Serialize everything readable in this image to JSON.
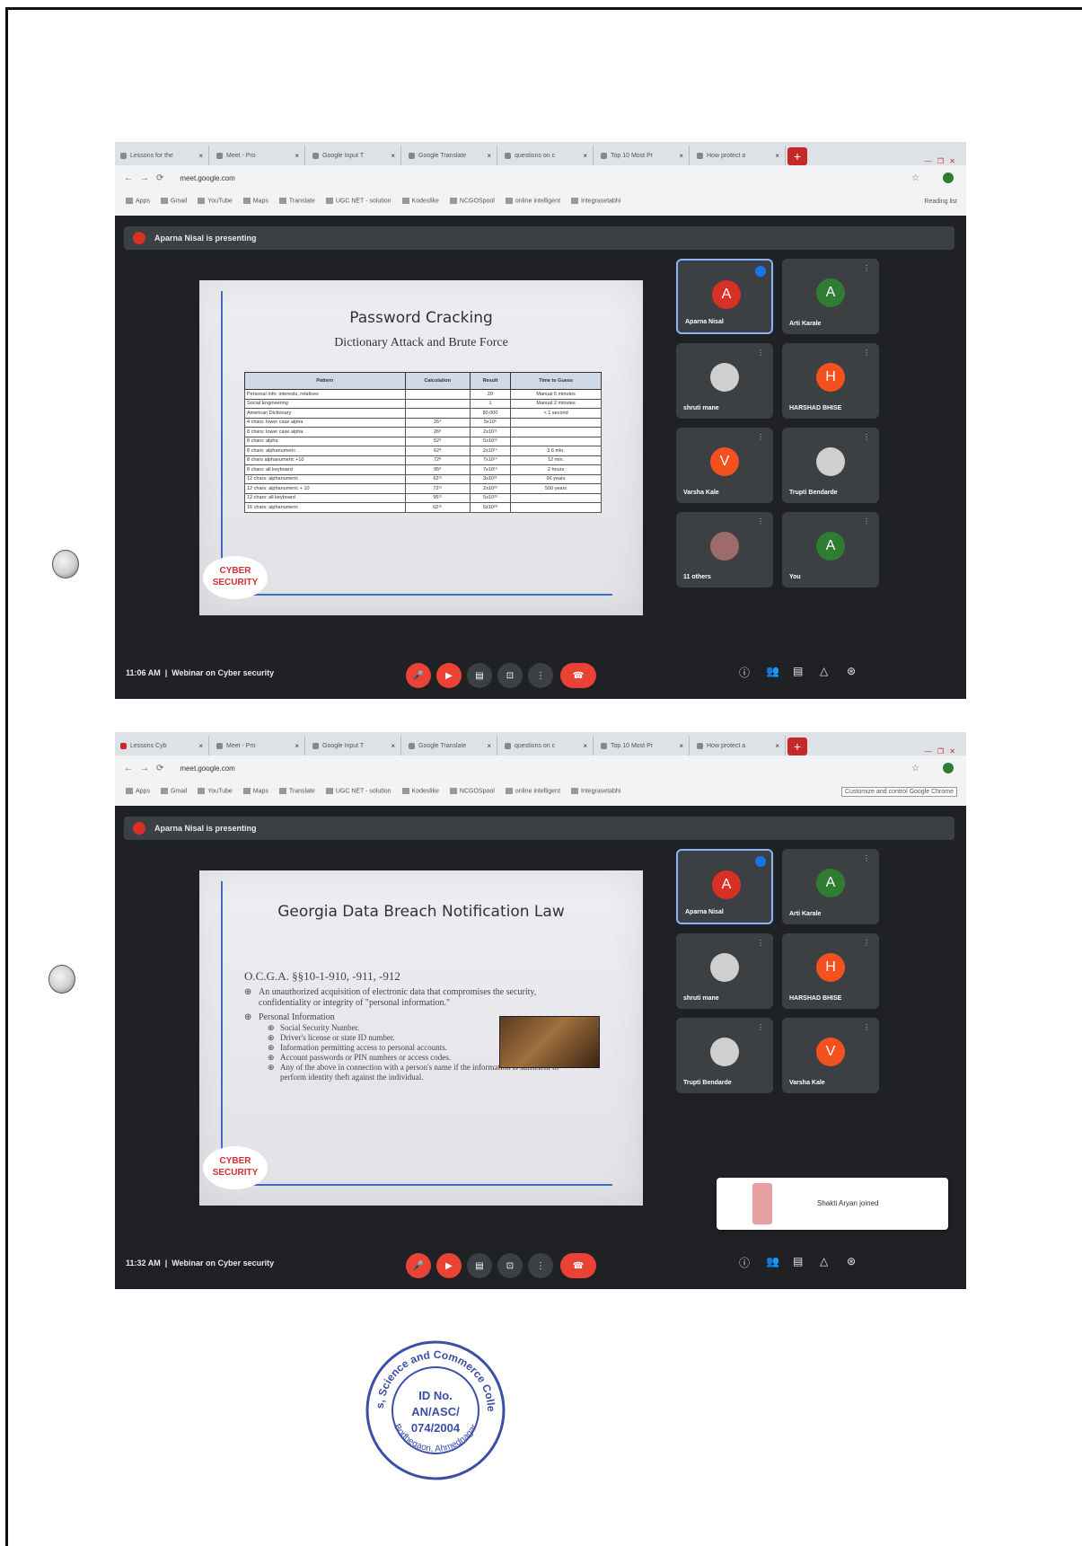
{
  "shot1": {
    "browser": {
      "tabs": [
        "Lessons for the",
        "Meet - Pro",
        "Google Input T",
        "Google Translate",
        "questions on c",
        "Top 10 Most Pr",
        "How protect a"
      ],
      "url": "meet.google.com",
      "bookmarks": [
        "Apps",
        "Gmail",
        "YouTube",
        "Maps",
        "Translate",
        "UGC NET - solution",
        "Kodeslike",
        "NCGOSpool",
        "online intelligent",
        "Integrasetabhi"
      ],
      "reading_list": "Reading list"
    },
    "presenting": "Aparna Nisal is presenting",
    "slide": {
      "title": "Password Cracking",
      "subtitle": "Dictionary Attack and Brute Force",
      "headers": [
        "Pattern",
        "Calculation",
        "Result",
        "Time to Guess"
      ],
      "rows": [
        [
          "Personal Info: interests, relatives",
          "",
          "20",
          "Manual 5 minutes"
        ],
        [
          "Social Engineering",
          "",
          "1",
          "Manual 2 minutes"
        ],
        [
          "American Dictionary",
          "",
          "80,000",
          "< 1 second"
        ],
        [
          "4 chars: lower case alpha",
          "26⁴",
          "5x10⁵",
          ""
        ],
        [
          "8 chars: lower case alpha",
          "26⁸",
          "2x10¹¹",
          ""
        ],
        [
          "8 chars: alpha",
          "52⁸",
          "5x10¹³",
          ""
        ],
        [
          "8 chars: alphanumeric",
          "62⁸",
          "2x10¹⁴",
          "3.6 min."
        ],
        [
          "8 chars alphanumeric +10",
          "72⁸",
          "7x10¹⁴",
          "12 min."
        ],
        [
          "8 chars: all keyboard",
          "95⁸",
          "7x10¹⁵",
          "2 hours"
        ],
        [
          "12 chars: alphanumeric",
          "62¹²",
          "3x10²¹",
          "96 years"
        ],
        [
          "12 chars: alphanumeric + 10",
          "72¹²",
          "2x10²²",
          "500 years"
        ],
        [
          "12 chars: all keyboard",
          "95¹²",
          "5x10²³",
          ""
        ],
        [
          "16 chars: alphanumeric",
          "62¹⁶",
          "5x10²⁸",
          ""
        ]
      ],
      "badge_line1": "CYBER",
      "badge_line2": "SECURITY"
    },
    "participants": [
      {
        "name": "Aparna Nisal",
        "initial": "A",
        "color": "#d93025"
      },
      {
        "name": "Arti Karale",
        "initial": "A",
        "color": "#2e7d32"
      },
      {
        "name": "shruti mane",
        "initial": "",
        "color": "#cfcfcf"
      },
      {
        "name": "HARSHAD BHISE",
        "initial": "H",
        "color": "#f4511e"
      },
      {
        "name": "Varsha Kale",
        "initial": "V",
        "color": "#f4511e"
      },
      {
        "name": "Trupti Bendarde",
        "initial": "",
        "color": "#cfcfcf"
      },
      {
        "name": "11 others",
        "initial": "",
        "color": "#9e6b6b"
      },
      {
        "name": "You",
        "initial": "A",
        "color": "#2e7d32"
      }
    ],
    "time": "11:06 AM",
    "meeting": "Webinar on Cyber security"
  },
  "shot2": {
    "browser": {
      "tabs": [
        "Lessons Cyb",
        "Meet - Pro",
        "Google Input T",
        "Google Translate",
        "questions on c",
        "Top 10 Most Pr",
        "How protect a"
      ],
      "url": "meet.google.com",
      "bookmarks": [
        "Apps",
        "Gmail",
        "YouTube",
        "Maps",
        "Translate",
        "UGC NET - solution",
        "Kodeslike",
        "NCGOSpool",
        "online intelligent",
        "Integrasetabhi"
      ],
      "reading_list": "Customize and control Google Chrome"
    },
    "presenting": "Aparna Nisal is presenting",
    "slide": {
      "title": "Georgia Data Breach Notification Law",
      "code": "O.C.G.A. §§10-1-910, -911, -912",
      "bullet1": "An unauthorized acquisition of electronic data that compromises the security, confidentiality or integrity of \"personal information.\"",
      "bullet2": "Personal Information",
      "subbullets": [
        "Social Security Number.",
        "Driver's license or state ID number.",
        "Information permitting access to personal accounts.",
        "Account passwords or PIN numbers or access codes.",
        "Any of the above in connection with a person's name if the information is sufficient to perform identity theft against the individual."
      ],
      "badge_line1": "CYBER",
      "badge_line2": "SECURITY"
    },
    "participants": [
      {
        "name": "Aparna Nisal",
        "initial": "A",
        "color": "#d93025"
      },
      {
        "name": "Arti Karale",
        "initial": "A",
        "color": "#2e7d32"
      },
      {
        "name": "shruti mane",
        "initial": "",
        "color": "#cfcfcf"
      },
      {
        "name": "HARSHAD BHISE",
        "initial": "H",
        "color": "#f4511e"
      },
      {
        "name": "Trupti Bendarde",
        "initial": "",
        "color": "#cfcfcf"
      },
      {
        "name": "Varsha Kale",
        "initial": "V",
        "color": "#f4511e"
      }
    ],
    "popup_name": "Shakti Aryan joined",
    "time": "11:32 AM",
    "meeting": "Webinar on Cyber security"
  },
  "stamp": {
    "ring_text": "Arts, Science and Commerce College",
    "bottom_text": "Bodhegaon, Ahmednagar",
    "line1": "ID No.",
    "line2": "AN/ASC/",
    "line3": "074/2004"
  }
}
